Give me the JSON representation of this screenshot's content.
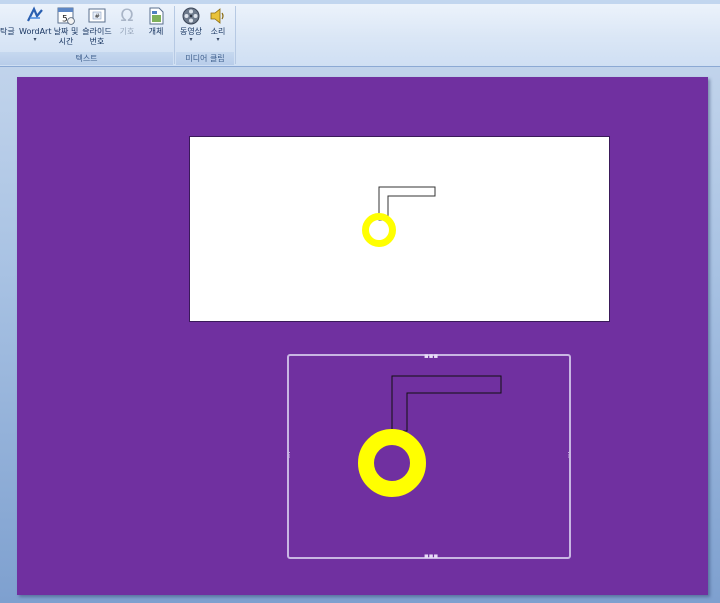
{
  "ribbon": {
    "text_group": {
      "label": "텍스트",
      "buttons": [
        {
          "label": "텍스트 상자 (partially visible)",
          "text": "탁글",
          "icon": "textbox-icon"
        },
        {
          "label": "WordArt",
          "text": "WordArt",
          "icon": "wordart-icon"
        },
        {
          "label": "날짜 및 시간",
          "line1": "날짜 및",
          "line2": "시간",
          "icon": "calendar-icon"
        },
        {
          "label": "슬라이드 번호",
          "line1": "슬라이드",
          "line2": "번호",
          "icon": "slide-number-icon"
        },
        {
          "label": "기호",
          "text": "기호",
          "icon": "omega-icon"
        },
        {
          "label": "개체",
          "text": "개체",
          "icon": "object-icon"
        }
      ]
    },
    "media_group": {
      "label": "미디어 클립",
      "buttons": [
        {
          "text": "동영상",
          "icon": "film-reel-icon"
        },
        {
          "text": "소리",
          "icon": "speaker-icon"
        }
      ]
    }
  },
  "colors": {
    "slide_background": "#7030a0",
    "ring": "#ffff00",
    "preview_background": "#ffffff"
  }
}
